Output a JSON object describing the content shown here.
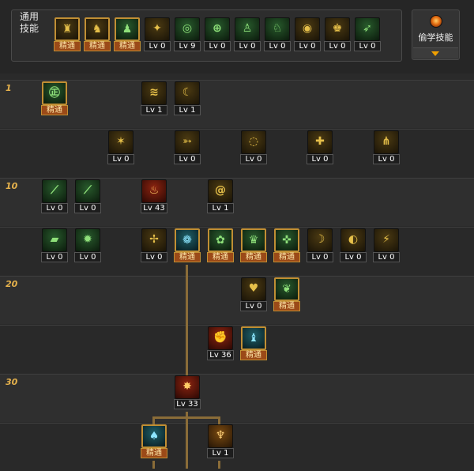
{
  "header": {
    "common_label_line1": "通用",
    "common_label_line2": "技能",
    "steal_label": "偷学技能",
    "steal_icon": "flame-orb-icon",
    "steal_dropdown_icon": "triangle-down-icon"
  },
  "mastered_label": "精通",
  "level_prefix": "Lv",
  "common_skills": [
    {
      "id": "c1",
      "icon": "sitting-figure-icon",
      "tone": "yellow",
      "mastered": true,
      "glyph": "♜"
    },
    {
      "id": "c2",
      "icon": "crouching-figure-icon",
      "tone": "yellow",
      "mastered": true,
      "glyph": "♞"
    },
    {
      "id": "c3",
      "icon": "running-figure-icon",
      "tone": "green",
      "mastered": true,
      "glyph": "♟"
    },
    {
      "id": "c4",
      "icon": "winged-emblem-icon",
      "tone": "yellow",
      "level": "0",
      "glyph": "✦"
    },
    {
      "id": "c5",
      "icon": "target-sight-icon",
      "tone": "green",
      "level": "9",
      "glyph": "◎"
    },
    {
      "id": "c6",
      "icon": "crosshair-icon",
      "tone": "green",
      "level": "0",
      "glyph": "⊕"
    },
    {
      "id": "c7",
      "icon": "jumping-figure-icon",
      "tone": "green",
      "level": "0",
      "glyph": "♙"
    },
    {
      "id": "c8",
      "icon": "kicking-figure-icon",
      "tone": "green",
      "level": "0",
      "glyph": "♘"
    },
    {
      "id": "c9",
      "icon": "eye-spiral-icon",
      "tone": "yellow",
      "level": "0",
      "glyph": "◉"
    },
    {
      "id": "c10",
      "icon": "armored-figure-icon",
      "tone": "yellow",
      "level": "0",
      "glyph": "♚"
    },
    {
      "id": "c11",
      "icon": "dash-figure-icon",
      "tone": "green",
      "level": "0",
      "glyph": "➶"
    }
  ],
  "row_labels": [
    {
      "row": 0,
      "text": "1"
    },
    {
      "row": 2,
      "text": "10"
    },
    {
      "row": 4,
      "text": "20"
    },
    {
      "row": 6,
      "text": "30"
    }
  ],
  "tree": [
    {
      "id": "t1",
      "row": 0,
      "col": 0,
      "icon": "dragon-scroll-icon",
      "tone": "green",
      "mastered": true,
      "glyph": "㊣"
    },
    {
      "id": "t2",
      "row": 0,
      "col": 3,
      "icon": "claw-slash-icon",
      "tone": "yellow",
      "level": "1",
      "glyph": "≋"
    },
    {
      "id": "t3",
      "row": 0,
      "col": 4,
      "icon": "sweep-slash-icon",
      "tone": "yellow",
      "level": "1",
      "glyph": "☾"
    },
    {
      "id": "t4",
      "row": 1,
      "col": 2,
      "icon": "burst-lines-icon",
      "tone": "yellow",
      "level": "0",
      "glyph": "✶"
    },
    {
      "id": "t5",
      "row": 1,
      "col": 4,
      "icon": "thrust-arrow-icon",
      "tone": "yellow",
      "level": "0",
      "glyph": "➳"
    },
    {
      "id": "t6",
      "row": 1,
      "col": 6,
      "icon": "whirlwind-icon",
      "tone": "yellow",
      "level": "0",
      "glyph": "◌"
    },
    {
      "id": "t7",
      "row": 1,
      "col": 8,
      "icon": "cross-shield-icon",
      "tone": "yellow",
      "level": "0",
      "glyph": "✚"
    },
    {
      "id": "t8",
      "row": 1,
      "col": 10,
      "icon": "triple-blade-icon",
      "tone": "yellow",
      "level": "0",
      "glyph": "⋔"
    },
    {
      "id": "t9",
      "row": 2,
      "col": 0,
      "icon": "green-blade-icon",
      "tone": "green",
      "level": "0",
      "glyph": "⟋"
    },
    {
      "id": "t10",
      "row": 2,
      "col": 1,
      "icon": "green-sword-icon",
      "tone": "green",
      "level": "0",
      "glyph": "⟋"
    },
    {
      "id": "t11",
      "row": 2,
      "col": 3,
      "icon": "flame-slash-icon",
      "tone": "red",
      "level": "43",
      "glyph": "♨"
    },
    {
      "id": "t12",
      "row": 2,
      "col": 5,
      "icon": "spiral-slash-icon",
      "tone": "yellow",
      "level": "1",
      "glyph": "@"
    },
    {
      "id": "t13",
      "row": 3,
      "col": 0,
      "icon": "jade-blade-icon",
      "tone": "green",
      "level": "0",
      "glyph": "▰"
    },
    {
      "id": "t14",
      "row": 3,
      "col": 1,
      "icon": "spiked-star-icon",
      "tone": "green",
      "level": "0",
      "glyph": "✹"
    },
    {
      "id": "t15",
      "row": 3,
      "col": 3,
      "icon": "cross-strike-icon",
      "tone": "yellow",
      "level": "0",
      "glyph": "✢"
    },
    {
      "id": "t16",
      "row": 3,
      "col": 4,
      "icon": "lotus-orb-icon",
      "tone": "teal",
      "mastered": true,
      "glyph": "❁"
    },
    {
      "id": "t17",
      "row": 3,
      "col": 5,
      "icon": "flower-orb-icon",
      "tone": "green",
      "mastered": true,
      "glyph": "✿"
    },
    {
      "id": "t18",
      "row": 3,
      "col": 6,
      "icon": "strong-figure-icon",
      "tone": "green",
      "mastered": true,
      "glyph": "♛"
    },
    {
      "id": "t19",
      "row": 3,
      "col": 7,
      "icon": "holy-cross-icon",
      "tone": "green",
      "mastered": true,
      "glyph": "✜"
    },
    {
      "id": "t20",
      "row": 3,
      "col": 8,
      "icon": "crescent-swirl-icon",
      "tone": "yellow",
      "level": "0",
      "glyph": "☽"
    },
    {
      "id": "t21",
      "row": 3,
      "col": 9,
      "icon": "moon-slash-icon",
      "tone": "yellow",
      "level": "0",
      "glyph": "◐"
    },
    {
      "id": "t22",
      "row": 3,
      "col": 10,
      "icon": "rising-flames-icon",
      "tone": "yellow",
      "level": "0",
      "glyph": "⚡"
    },
    {
      "id": "t23",
      "row": 4,
      "col": 6,
      "icon": "heart-shield-icon",
      "tone": "yellow",
      "level": "0",
      "glyph": "♥"
    },
    {
      "id": "t24",
      "row": 4,
      "col": 7,
      "icon": "green-dragon-icon",
      "tone": "green",
      "mastered": true,
      "glyph": "❦"
    },
    {
      "id": "t25",
      "row": 5,
      "col": 5,
      "icon": "red-fist-icon",
      "tone": "red",
      "level": "36",
      "glyph": "✊"
    },
    {
      "id": "t26",
      "row": 5,
      "col": 6,
      "icon": "blue-figure-icon",
      "tone": "teal",
      "mastered": true,
      "glyph": "♝"
    },
    {
      "id": "t27",
      "row": 6,
      "col": 4,
      "icon": "red-explosion-icon",
      "tone": "red",
      "level": "33",
      "glyph": "✸"
    },
    {
      "id": "t28",
      "row": 7,
      "col": 3,
      "icon": "blue-wing-icon",
      "tone": "teal",
      "mastered": true,
      "glyph": "♠"
    },
    {
      "id": "t29",
      "row": 7,
      "col": 5,
      "icon": "golden-horn-icon",
      "tone": "orange",
      "level": "1",
      "glyph": "♆"
    }
  ]
}
